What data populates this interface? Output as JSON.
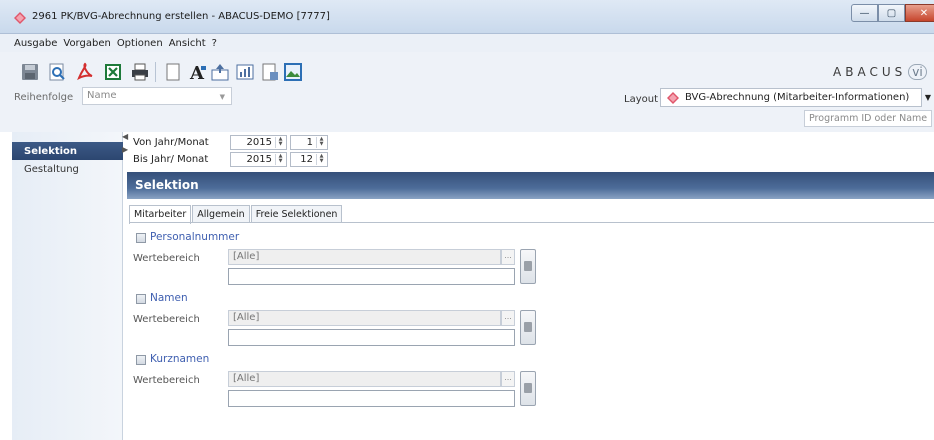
{
  "window": {
    "title": "2961 PK/BVG-Abrechnung erstellen - ABACUS-DEMO [7777]",
    "controls": {
      "minimize": "—",
      "maximize": "▢",
      "close": "✕"
    }
  },
  "menubar": {
    "items": [
      "Ausgabe",
      "Vorgaben",
      "Optionen",
      "Ansicht",
      "?"
    ]
  },
  "toolbar": {
    "icons": [
      "save-icon",
      "preview-icon",
      "pdf-icon",
      "excel-icon",
      "print-icon",
      "page-icon",
      "font-icon",
      "export-icon",
      "chart-icon",
      "document-icon",
      "image-icon"
    ],
    "brand": "ABACUS",
    "brand_suffix": "vi"
  },
  "order": {
    "label": "Reihenfolge",
    "value": "Name"
  },
  "layout": {
    "label": "Layout",
    "value": "BVG-Abrechnung (Mitarbeiter-Informationen)"
  },
  "program_search": {
    "placeholder": "Programm ID oder Name"
  },
  "nav": {
    "items": [
      {
        "label": "Selektion",
        "active": true
      },
      {
        "label": "Gestaltung",
        "active": false
      }
    ]
  },
  "period": {
    "from_label": "Von Jahr/Monat",
    "from_year": "2015",
    "from_month": "1",
    "to_label": "Bis Jahr/ Monat",
    "to_year": "2015",
    "to_month": "12"
  },
  "section": {
    "title": "Selektion"
  },
  "tabs": [
    {
      "label": "Mitarbeiter",
      "active": true
    },
    {
      "label": "Allgemein",
      "active": false
    },
    {
      "label": "Freie Selektionen",
      "active": false
    }
  ],
  "groups": [
    {
      "label": "Personalnummer",
      "range_label": "Wertebereich",
      "range_value": "[Alle]",
      "more": "..."
    },
    {
      "label": "Namen",
      "range_label": "Wertebereich",
      "range_value": "[Alle]",
      "more": "..."
    },
    {
      "label": "Kurznamen",
      "range_label": "Wertebereich",
      "range_value": "[Alle]",
      "more": "..."
    }
  ],
  "colors": {
    "accent": "#2c4670",
    "section_header": "#3d5a86",
    "link_blue": "#3f5fb0",
    "layout_icon": "#e0566b"
  }
}
